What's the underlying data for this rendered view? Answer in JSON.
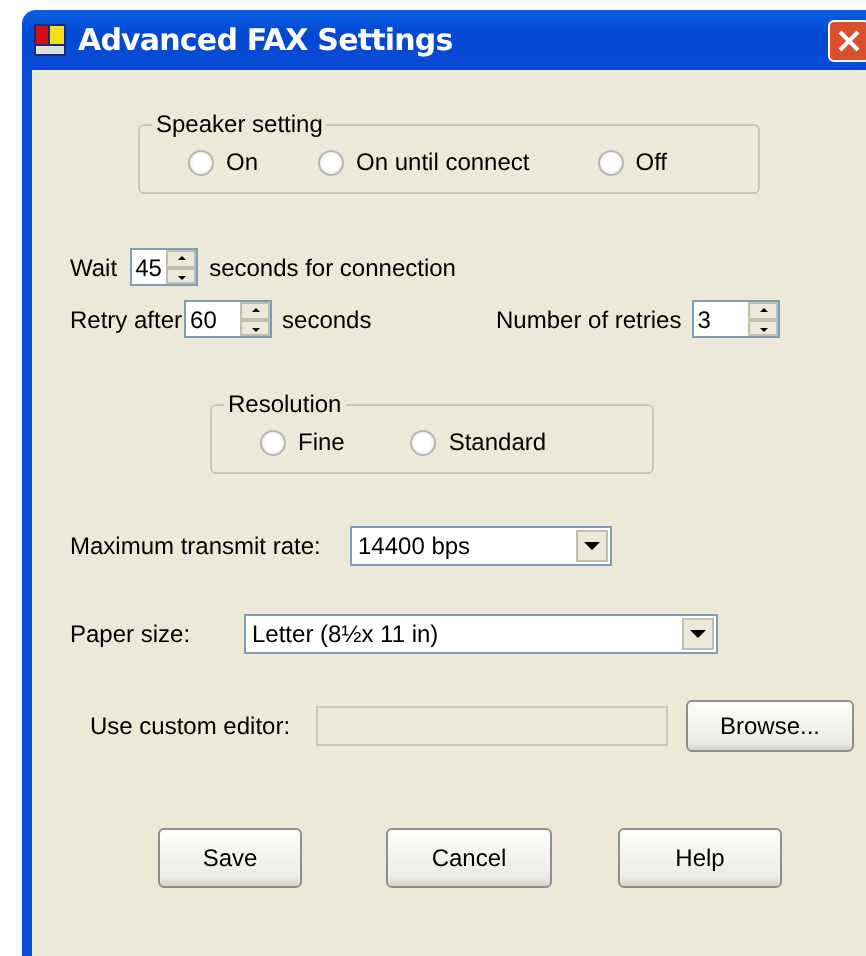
{
  "window": {
    "title": "Advanced FAX Settings"
  },
  "speaker_setting": {
    "label": "Speaker setting",
    "options": [
      {
        "label": "On",
        "selected": false
      },
      {
        "label": "On until connect",
        "selected": false
      },
      {
        "label": "Off",
        "selected": false
      }
    ]
  },
  "wait": {
    "label": "Wait",
    "value": "45",
    "suffix": "seconds for connection"
  },
  "retry": {
    "label": "Retry after",
    "value": "60",
    "suffix": "seconds"
  },
  "retries": {
    "label": "Number of retries",
    "value": "3"
  },
  "resolution": {
    "label": "Resolution",
    "options": [
      {
        "label": "Fine",
        "selected": false
      },
      {
        "label": "Standard",
        "selected": false
      }
    ]
  },
  "max_rate": {
    "label": "Maximum transmit rate:",
    "value": "14400 bps"
  },
  "paper_size": {
    "label": "Paper size:",
    "value": "Letter (8½x 11 in)"
  },
  "custom_editor": {
    "label": "Use custom editor:",
    "button": "Browse..."
  },
  "buttons": [
    "Save",
    "Cancel",
    "Help"
  ]
}
